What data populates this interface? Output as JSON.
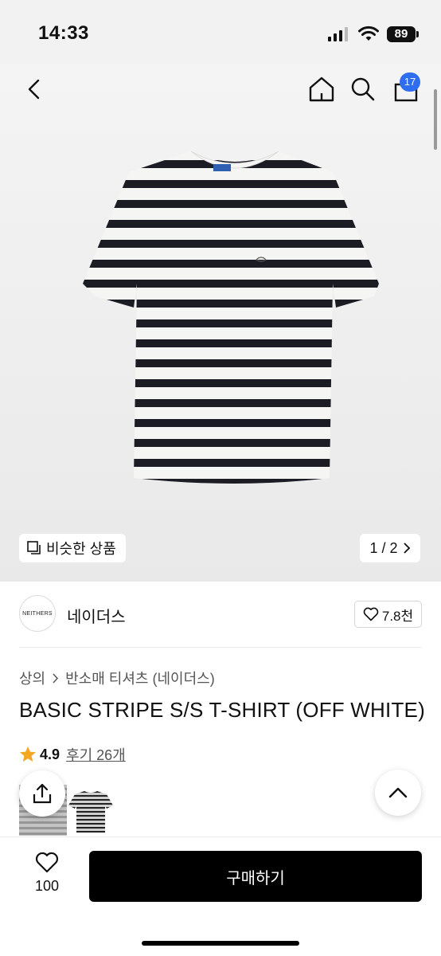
{
  "status_bar": {
    "time": "14:33",
    "battery": "89"
  },
  "header": {
    "cart_count": "17"
  },
  "gallery": {
    "similar_label": "비슷한 상품",
    "page_indicator": "1 / 2"
  },
  "brand": {
    "logo_text": "NEITHERS",
    "name": "네이더스",
    "likes": "7.8천"
  },
  "breadcrumb": {
    "category": "상의",
    "subcategory": "반소매 티셔츠 (네이더스)"
  },
  "product": {
    "title": "BASIC STRIPE S/S T-SHIRT (OFF WHITE)",
    "rating": "4.9",
    "reviews": "후기 26개"
  },
  "bottom": {
    "wish_count": "100",
    "buy_label": "구매하기"
  },
  "colors": {
    "accent_badge": "#2f6df0",
    "star": "#f5a623",
    "stripe": "#1c1c24",
    "shirt": "#f5f5f3"
  }
}
